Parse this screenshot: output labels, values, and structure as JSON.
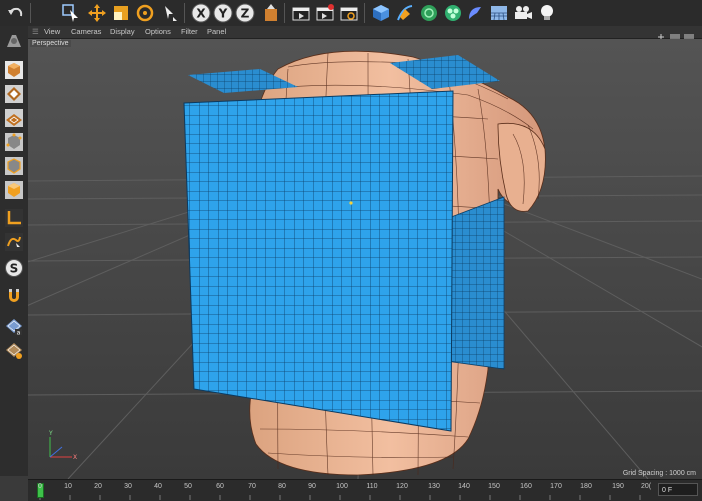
{
  "viewport": {
    "label": "Perspective",
    "grid_spacing": "Grid Spacing : 1000 cm"
  },
  "menu": {
    "items": [
      "View",
      "Cameras",
      "Display",
      "Options",
      "Filter",
      "Panel"
    ]
  },
  "toolbar": {
    "icons": [
      "undo-icon",
      "live-selection-icon",
      "move-icon",
      "scale-icon",
      "rotate-icon",
      "recent-tools-icon",
      "x-axis-lock-icon",
      "y-axis-lock-icon",
      "z-axis-lock-icon",
      "coordinate-system-icon",
      "render-view-icon",
      "render-picture-viewer-icon",
      "render-settings-icon",
      "cube-icon",
      "pen-icon",
      "subdivision-icon",
      "cloner-icon",
      "deformer-icon",
      "floor-icon",
      "camera-icon",
      "light-icon"
    ],
    "axis_labels": [
      "X",
      "Y",
      "Z"
    ]
  },
  "timeline": {
    "ticks": [
      "0",
      "10",
      "20",
      "30",
      "40",
      "50",
      "60",
      "70",
      "80",
      "90",
      "100",
      "110",
      "120",
      "130",
      "140",
      "150",
      "160",
      "170",
      "180",
      "190",
      "20("
    ],
    "frame_value": "0 F"
  }
}
